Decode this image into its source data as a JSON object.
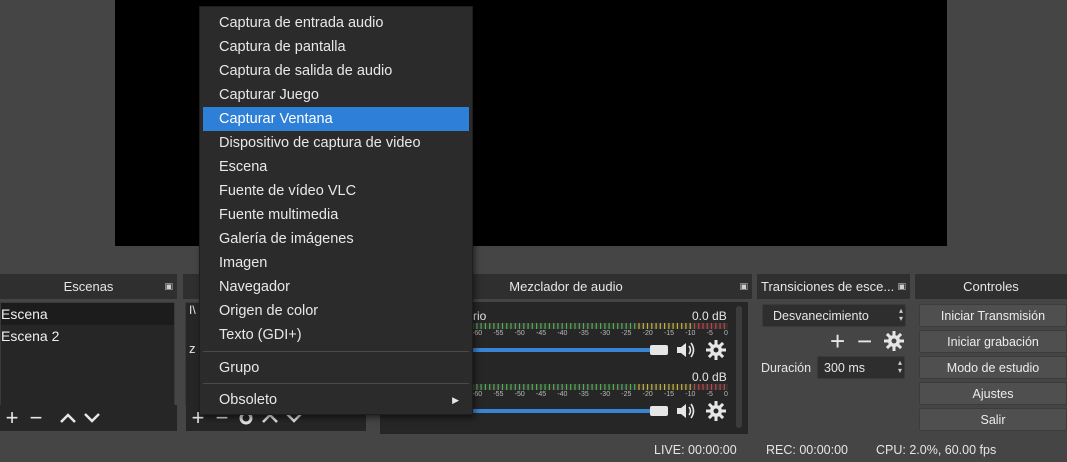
{
  "docks": {
    "scenes": {
      "title": "Escenas",
      "items": [
        "Escena",
        "Escena 2"
      ]
    },
    "sources": {
      "partial_items": [
        "I\\",
        "z"
      ]
    },
    "mixer": {
      "title": "Mezclador de audio",
      "tracks": [
        {
          "name_partial": "rio",
          "db": "0.0 dB",
          "volume": 1.0
        },
        {
          "name_partial": "",
          "db": "0.0 dB",
          "volume": 1.0
        }
      ],
      "ticks": [
        "-60",
        "-55",
        "-50",
        "-45",
        "-40",
        "-35",
        "-30",
        "-25",
        "-20",
        "-15",
        "-10",
        "-5",
        "0"
      ]
    },
    "transitions": {
      "title": "Transiciones de esce...",
      "selected": "Desvanecimiento",
      "duration_label": "Duración",
      "duration_value": "300 ms"
    },
    "controls": {
      "title": "Controles",
      "buttons": [
        "Iniciar Transmisión",
        "Iniciar grabación",
        "Modo de estudio",
        "Ajustes",
        "Salir"
      ]
    }
  },
  "status": {
    "live": "LIVE: 00:00:00",
    "rec": "REC: 00:00:00",
    "cpu": "CPU: 2.0%, 60.00 fps"
  },
  "context_menu": {
    "items": [
      "Captura de entrada audio",
      "Captura de pantalla",
      "Captura de salida de audio",
      "Capturar Juego",
      "Capturar Ventana",
      "Dispositivo de captura de video",
      "Escena",
      "Fuente de vídeo VLC",
      "Fuente multimedia",
      "Galería de imágenes",
      "Imagen",
      "Navegador",
      "Origen de color",
      "Texto (GDI+)"
    ],
    "highlighted_index": 4,
    "group": "Grupo",
    "deprecated": "Obsoleto"
  },
  "colors": {
    "highlight": "#2d7fd8",
    "slider": "#3a84d4",
    "meter_green": "#4caf50",
    "meter_yellow": "#c8b232",
    "meter_red": "#c84040"
  }
}
